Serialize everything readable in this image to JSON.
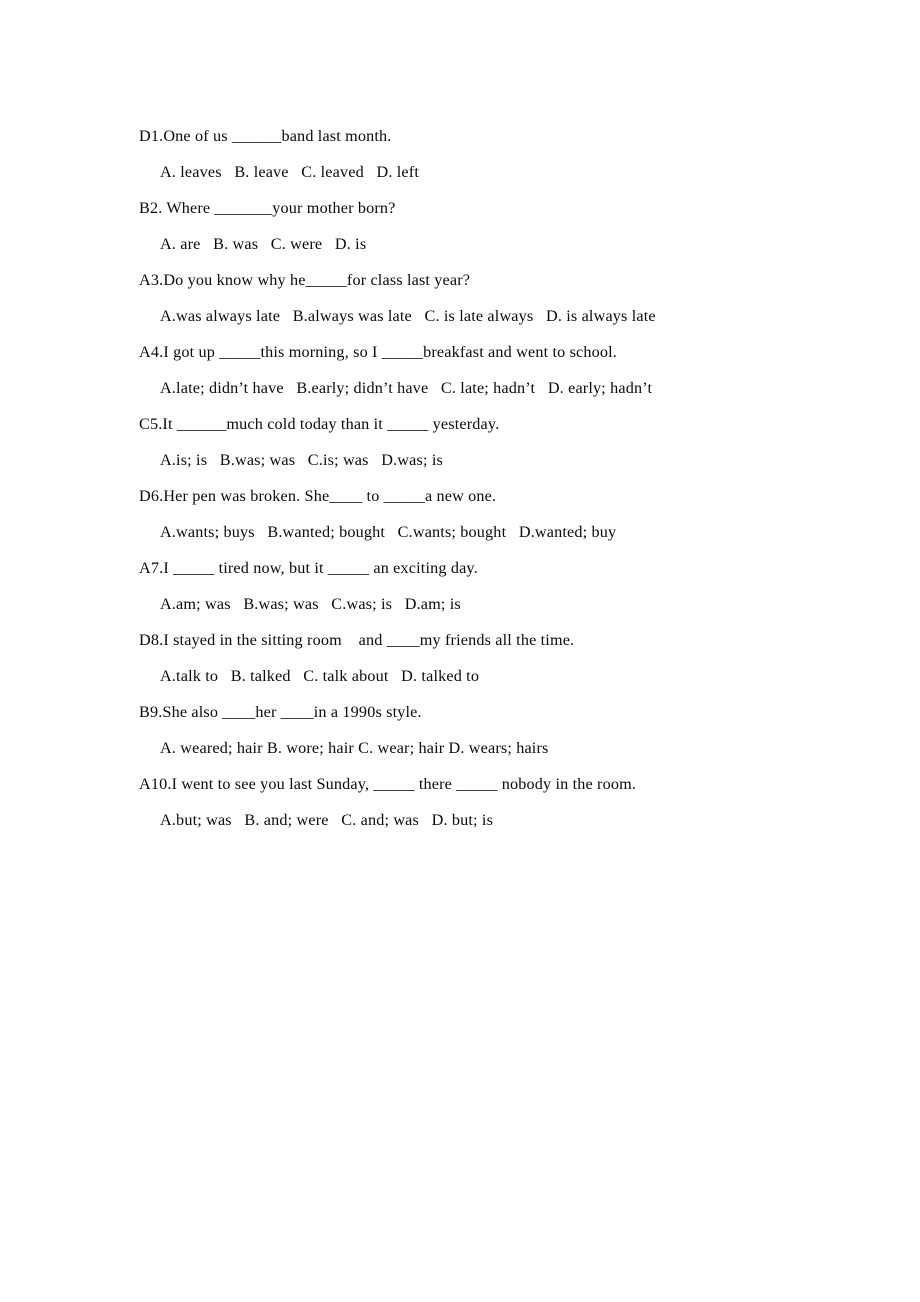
{
  "document": {
    "type": "worksheet",
    "subject": "English grammar multiple choice",
    "page_background": "#ffffff",
    "text_color": "#000000"
  },
  "questions": [
    {
      "id": "q1",
      "answer_key": "D",
      "number": "1",
      "stem": "D1.One of us ______band last month.",
      "options_line": "A. leaves   B. leave   C. leaved   D. left",
      "options": [
        {
          "letter": "A",
          "text": "leaves"
        },
        {
          "letter": "B",
          "text": "leave"
        },
        {
          "letter": "C",
          "text": "leaved"
        },
        {
          "letter": "D",
          "text": "left"
        }
      ]
    },
    {
      "id": "q2",
      "answer_key": "B",
      "number": "2",
      "stem": "B2. Where _______your mother born?",
      "options_line": "A. are   B. was   C. were   D. is",
      "options": [
        {
          "letter": "A",
          "text": "are"
        },
        {
          "letter": "B",
          "text": "was"
        },
        {
          "letter": "C",
          "text": "were"
        },
        {
          "letter": "D",
          "text": "is"
        }
      ]
    },
    {
      "id": "q3",
      "answer_key": "A",
      "number": "3",
      "stem": "A3.Do you know why he_____for class last year?",
      "options_line": "A.was always late   B.always was late   C. is late always   D. is always late",
      "options": [
        {
          "letter": "A",
          "text": "was always late"
        },
        {
          "letter": "B",
          "text": "always was late"
        },
        {
          "letter": "C",
          "text": "is late always"
        },
        {
          "letter": "D",
          "text": "is always late"
        }
      ]
    },
    {
      "id": "q4",
      "answer_key": "A",
      "number": "4",
      "stem": "A4.I got up _____this morning, so I _____breakfast and went to school.",
      "options_line": "A.late; didn’t have   B.early; didn’t have   C. late; hadn’t   D. early; hadn’t",
      "options": [
        {
          "letter": "A",
          "text": "late; didn’t have"
        },
        {
          "letter": "B",
          "text": "early; didn’t have"
        },
        {
          "letter": "C",
          "text": "late; hadn’t"
        },
        {
          "letter": "D",
          "text": "early; hadn’t"
        }
      ]
    },
    {
      "id": "q5",
      "answer_key": "C",
      "number": "5",
      "stem": "C5.It ______much cold today than it _____ yesterday.",
      "options_line": "A.is; is   B.was; was   C.is; was   D.was; is",
      "options": [
        {
          "letter": "A",
          "text": "is; is"
        },
        {
          "letter": "B",
          "text": "was; was"
        },
        {
          "letter": "C",
          "text": "is; was"
        },
        {
          "letter": "D",
          "text": "was; is"
        }
      ]
    },
    {
      "id": "q6",
      "answer_key": "D",
      "number": "6",
      "stem": "D6.Her pen was broken. She____ to _____a new one.",
      "options_line": "A.wants; buys   B.wanted; bought   C.wants; bought   D.wanted; buy",
      "options": [
        {
          "letter": "A",
          "text": "wants; buys"
        },
        {
          "letter": "B",
          "text": "wanted; bought"
        },
        {
          "letter": "C",
          "text": "wants; bought"
        },
        {
          "letter": "D",
          "text": "wanted; buy"
        }
      ]
    },
    {
      "id": "q7",
      "answer_key": "A",
      "number": "7",
      "stem": "A7.I _____ tired now, but it _____ an exciting day.",
      "options_line": "A.am; was   B.was; was   C.was; is   D.am; is",
      "options": [
        {
          "letter": "A",
          "text": "am; was"
        },
        {
          "letter": "B",
          "text": "was; was"
        },
        {
          "letter": "C",
          "text": "was; is"
        },
        {
          "letter": "D",
          "text": "am; is"
        }
      ]
    },
    {
      "id": "q8",
      "answer_key": "D",
      "number": "8",
      "stem": "D8.I stayed in the sitting room    and ____my friends all the time.",
      "options_line": "A.talk to   B. talked   C. talk about   D. talked to",
      "options": [
        {
          "letter": "A",
          "text": "talk to"
        },
        {
          "letter": "B",
          "text": "talked"
        },
        {
          "letter": "C",
          "text": "talk about"
        },
        {
          "letter": "D",
          "text": "talked to"
        }
      ]
    },
    {
      "id": "q9",
      "answer_key": "B",
      "number": "9",
      "stem": "B9.She also ____her ____in a 1990s style.",
      "options_line": "A. weared; hair B. wore; hair C. wear; hair D. wears; hairs",
      "options": [
        {
          "letter": "A",
          "text": "weared; hair"
        },
        {
          "letter": "B",
          "text": "wore; hair"
        },
        {
          "letter": "C",
          "text": "wear; hair"
        },
        {
          "letter": "D",
          "text": "wears; hairs"
        }
      ]
    },
    {
      "id": "q10",
      "answer_key": "A",
      "number": "10",
      "stem": "A10.I went to see you last Sunday, _____ there _____ nobody in the room.",
      "options_line": "A.but; was   B. and; were   C. and; was   D. but; is",
      "options": [
        {
          "letter": "A",
          "text": "but; was"
        },
        {
          "letter": "B",
          "text": "and; were"
        },
        {
          "letter": "C",
          "text": "and; was"
        },
        {
          "letter": "D",
          "text": "but; is"
        }
      ]
    }
  ]
}
